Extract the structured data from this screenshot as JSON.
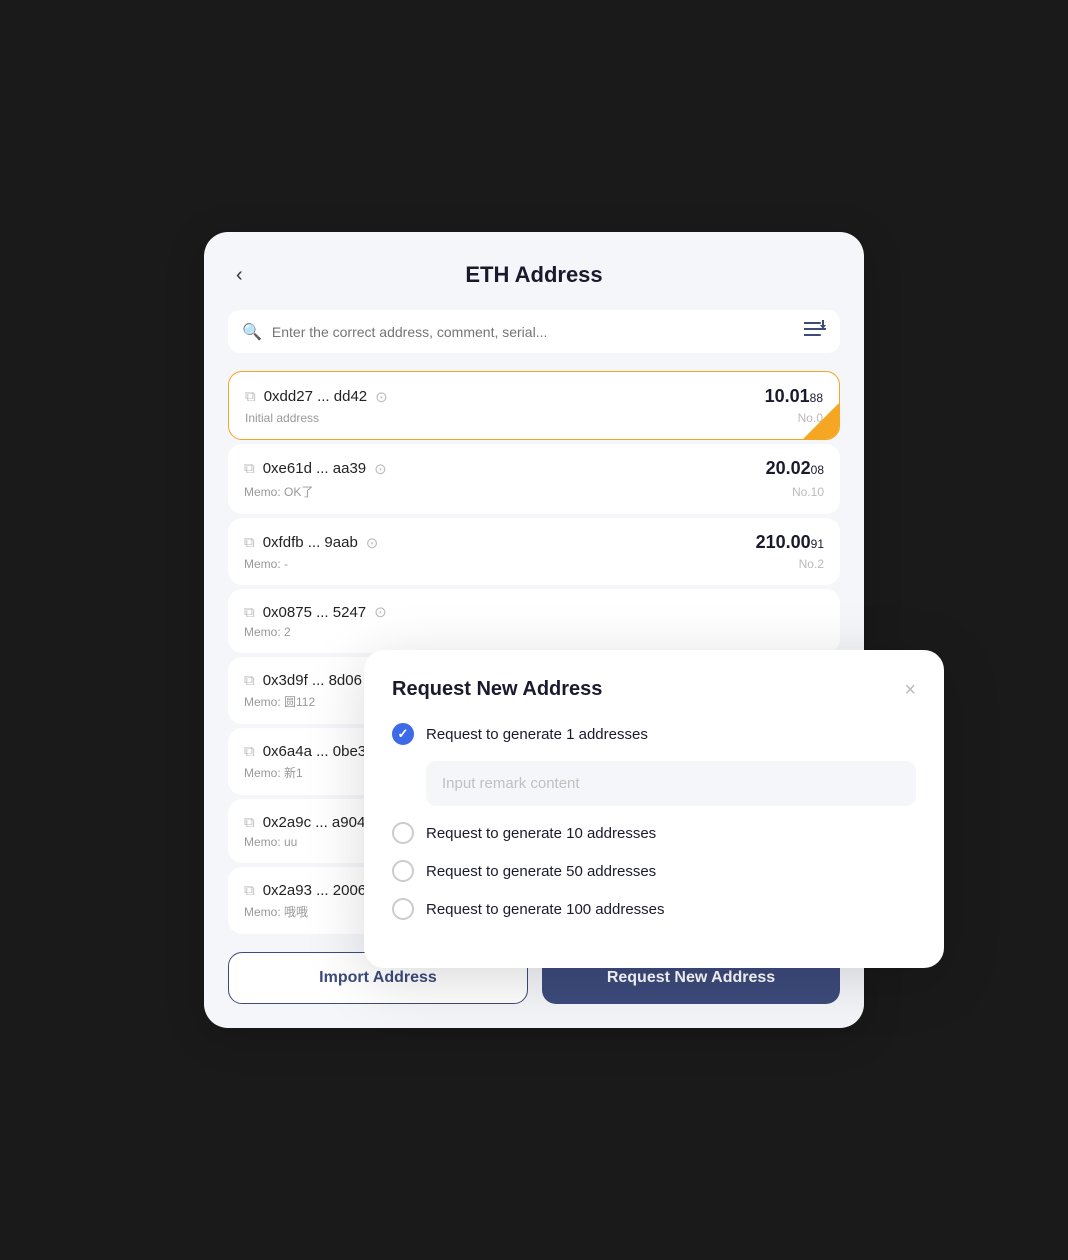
{
  "header": {
    "back_label": "‹",
    "title": "ETH Address"
  },
  "search": {
    "placeholder": "Enter the correct address, comment, serial..."
  },
  "filter_icon": "≡↕",
  "addresses": [
    {
      "address": "0xdd27 ... dd42",
      "memo": "Initial address",
      "balance_main": "10.01",
      "balance_dec": "88",
      "no": "No.0",
      "selected": true
    },
    {
      "address": "0xe61d ... aa39",
      "memo": "Memo: OK了",
      "balance_main": "20.02",
      "balance_dec": "08",
      "no": "No.10",
      "selected": false
    },
    {
      "address": "0xfdfb ... 9aab",
      "memo": "Memo: -",
      "balance_main": "210.00",
      "balance_dec": "91",
      "no": "No.2",
      "selected": false
    },
    {
      "address": "0x0875 ... 5247",
      "memo": "Memo: 2",
      "balance_main": "",
      "balance_dec": "",
      "no": "",
      "selected": false
    },
    {
      "address": "0x3d9f ... 8d06",
      "memo": "Memo: 圆112",
      "balance_main": "",
      "balance_dec": "",
      "no": "",
      "selected": false
    },
    {
      "address": "0x6a4a ... 0be3",
      "memo": "Memo: 新1",
      "balance_main": "",
      "balance_dec": "",
      "no": "",
      "selected": false
    },
    {
      "address": "0x2a9c ... a904",
      "memo": "Memo: uu",
      "balance_main": "",
      "balance_dec": "",
      "no": "",
      "selected": false
    },
    {
      "address": "0x2a93 ... 2006",
      "memo": "Memo: 哦哦",
      "balance_main": "",
      "balance_dec": "",
      "no": "",
      "selected": false
    }
  ],
  "buttons": {
    "import": "Import Address",
    "request": "Request New Address"
  },
  "modal": {
    "title": "Request New Address",
    "close_icon": "×",
    "options": [
      {
        "label": "Request to generate 1 addresses",
        "checked": true
      },
      {
        "label": "Request to generate 10 addresses",
        "checked": false
      },
      {
        "label": "Request to generate 50 addresses",
        "checked": false
      },
      {
        "label": "Request to generate 100 addresses",
        "checked": false
      }
    ],
    "remark_placeholder": "Input remark content"
  }
}
